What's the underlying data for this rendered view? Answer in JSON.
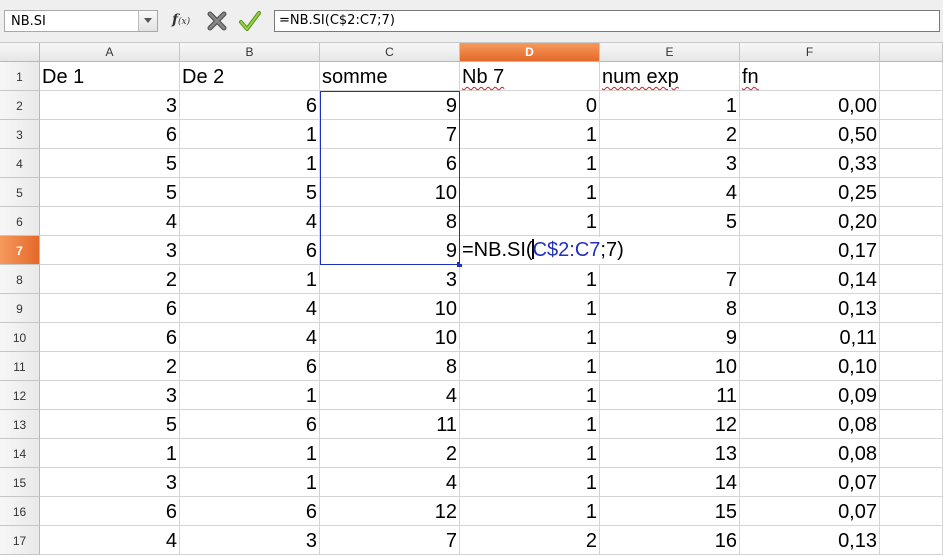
{
  "toolbar": {
    "name_box": "NB.SI",
    "formula": "=NB.SI(C$2:C7;7)",
    "fx_label": "f",
    "fx_sub": "(x)"
  },
  "columns": [
    "A",
    "B",
    "C",
    "D",
    "E",
    "F"
  ],
  "active_column": "D",
  "active_row": "7",
  "rows": [
    {
      "num": "1",
      "cells": [
        "De 1",
        "De 2",
        "somme",
        "Nb 7",
        "num exp",
        "fn"
      ]
    },
    {
      "num": "2",
      "cells": [
        "3",
        "6",
        "9",
        "0",
        "1",
        "0,00"
      ]
    },
    {
      "num": "3",
      "cells": [
        "6",
        "1",
        "7",
        "1",
        "2",
        "0,50"
      ]
    },
    {
      "num": "4",
      "cells": [
        "5",
        "1",
        "6",
        "1",
        "3",
        "0,33"
      ]
    },
    {
      "num": "5",
      "cells": [
        "5",
        "5",
        "10",
        "1",
        "4",
        "0,25"
      ]
    },
    {
      "num": "6",
      "cells": [
        "4",
        "4",
        "8",
        "1",
        "5",
        "0,20"
      ]
    },
    {
      "num": "7",
      "cells": [
        "3",
        "6",
        "9",
        "",
        "",
        "0,17"
      ]
    },
    {
      "num": "8",
      "cells": [
        "2",
        "1",
        "3",
        "1",
        "7",
        "0,14"
      ]
    },
    {
      "num": "9",
      "cells": [
        "6",
        "4",
        "10",
        "1",
        "8",
        "0,13"
      ]
    },
    {
      "num": "10",
      "cells": [
        "6",
        "4",
        "10",
        "1",
        "9",
        "0,11"
      ]
    },
    {
      "num": "11",
      "cells": [
        "2",
        "6",
        "8",
        "1",
        "10",
        "0,10"
      ]
    },
    {
      "num": "12",
      "cells": [
        "3",
        "1",
        "4",
        "1",
        "11",
        "0,09"
      ]
    },
    {
      "num": "13",
      "cells": [
        "5",
        "6",
        "11",
        "1",
        "12",
        "0,08"
      ]
    },
    {
      "num": "14",
      "cells": [
        "1",
        "1",
        "2",
        "1",
        "13",
        "0,08"
      ]
    },
    {
      "num": "15",
      "cells": [
        "3",
        "1",
        "4",
        "1",
        "14",
        "0,07"
      ]
    },
    {
      "num": "16",
      "cells": [
        "6",
        "6",
        "12",
        "1",
        "15",
        "0,07"
      ]
    },
    {
      "num": "17",
      "cells": [
        "4",
        "3",
        "7",
        "2",
        "16",
        "0,13"
      ]
    }
  ],
  "editing": {
    "prefix": "=NB.SI(",
    "ref": "C$2:C7",
    "suffix": ";7)"
  },
  "colors": {
    "active_header": "#e4692a",
    "range_border": "#1f2fbf",
    "spellcheck": "#d02020"
  }
}
